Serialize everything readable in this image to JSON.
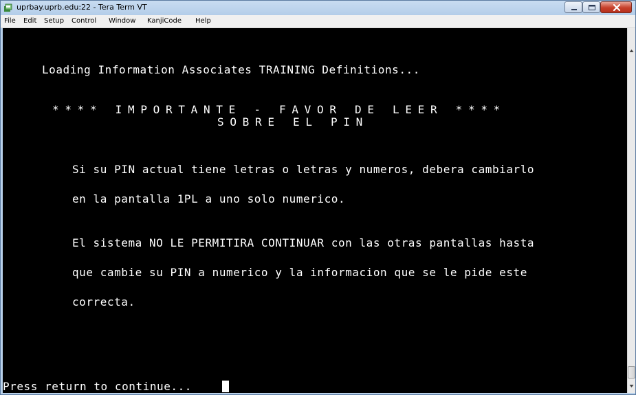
{
  "window": {
    "title": "uprbay.uprb.edu:22 - Tera Term VT"
  },
  "menu": {
    "items": [
      "File",
      "Edit",
      "Setup",
      "Control",
      "Window",
      "KanjiCode",
      "Help"
    ]
  },
  "terminal": {
    "loading": "Loading Information Associates TRAINING Definitions...",
    "important_line1": "**** IMPORTANTE - FAVOR DE LEER ****",
    "important_line2": "SOBRE EL PIN",
    "para1_line1": "Si su PIN actual tiene letras o letras y numeros, debera cambiarlo",
    "para1_line2": "en la pantalla 1PL a uno solo numerico.",
    "para2_line1": "El sistema NO LE PERMITIRA CONTINUAR con las otras pantallas hasta",
    "para2_line2": "que cambie su PIN a numerico y la informacion que se le pide este",
    "para2_line3": "correcta.",
    "prompt": "Press return to continue..."
  },
  "colors": {
    "terminal_bg": "#000000",
    "terminal_fg": "#ffffff",
    "close_button": "#c7402a"
  },
  "icons": {
    "app": "tera-term-icon",
    "minimize": "minimize-icon",
    "maximize": "maximize-icon",
    "close": "close-icon"
  }
}
